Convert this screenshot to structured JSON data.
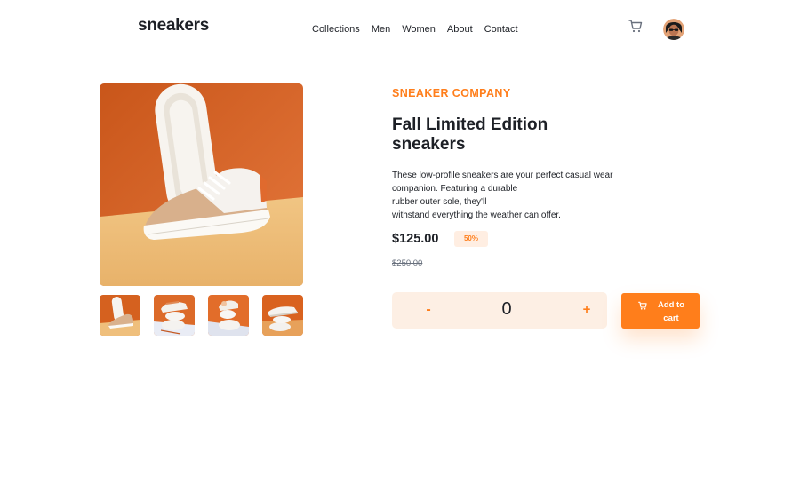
{
  "header": {
    "logo": "sneakers",
    "nav": [
      "Collections",
      "Men",
      "Women",
      "About",
      "Contact"
    ],
    "cart_icon": "cart-icon",
    "avatar": "avatar"
  },
  "gallery": {
    "main_image": "sneaker-photo",
    "thumbnails": [
      "thumbnail-1",
      "thumbnail-2",
      "thumbnail-3",
      "thumbnail-4"
    ]
  },
  "product": {
    "company": "SNEAKER COMPANY",
    "title": "Fall Limited Edition sneakers",
    "description": [
      "These low-profile sneakers are your perfect casual wear",
      "companion. Featuring a durable",
      "rubber outer sole, they'll",
      "withstand everything the weather can offer."
    ],
    "price": "$125.00",
    "discount": "50%",
    "old_price": "$250.00"
  },
  "cart_controls": {
    "minus": "-",
    "quantity": "0",
    "plus": "+",
    "add_to_cart": "Add to cart"
  },
  "colors": {
    "accent": "#ff7e1b",
    "accent_pale": "#ffeee2",
    "text_dark": "#1d2026",
    "text_muted": "#68707d"
  }
}
